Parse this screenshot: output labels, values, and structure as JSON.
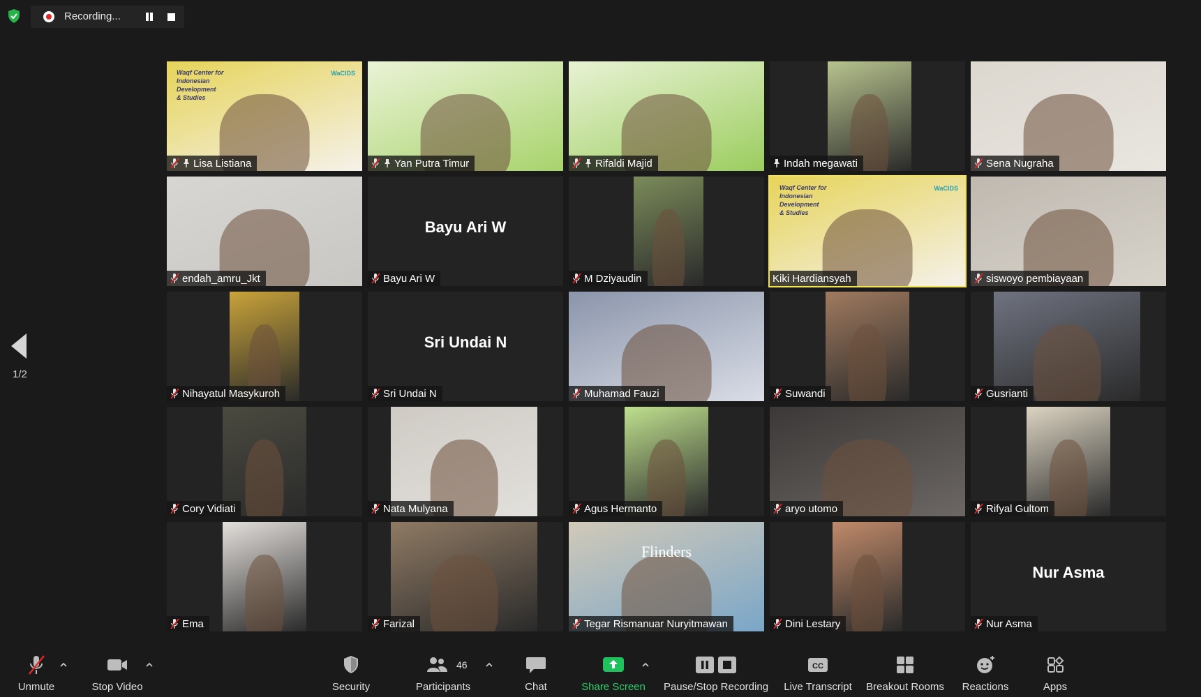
{
  "top_bar": {
    "recording_label": "Recording..."
  },
  "pager": {
    "indicator": "1/2"
  },
  "colors": {
    "active_speaker": "#f3e34d",
    "share": "#1ec15c",
    "mic_off": "#e02828"
  },
  "participants": [
    {
      "name": "Lisa Listiana",
      "muted": true,
      "pinned": true,
      "content": "video",
      "banner": "Waqf Center for\nIndonesian\nDevelopment\n& Studies",
      "brand": "WaCIDS"
    },
    {
      "name": "Yan Putra Timur",
      "muted": true,
      "pinned": true,
      "content": "video"
    },
    {
      "name": "Rifaldi Majid",
      "muted": true,
      "pinned": true,
      "content": "video"
    },
    {
      "name": "Indah megawati",
      "muted": false,
      "pinned": true,
      "content": "video"
    },
    {
      "name": "Sena Nugraha",
      "muted": true,
      "pinned": false,
      "content": "video"
    },
    {
      "name": "endah_amru_Jkt",
      "muted": true,
      "pinned": false,
      "content": "video"
    },
    {
      "name": "Bayu Ari W",
      "muted": true,
      "pinned": false,
      "content": "name",
      "display": "Bayu Ari W"
    },
    {
      "name": "M Dziyaudin",
      "muted": true,
      "pinned": false,
      "content": "video"
    },
    {
      "name": "Kiki Hardiansyah",
      "muted": false,
      "pinned": false,
      "content": "video",
      "active": true,
      "banner": "Waqf Center for\nIndonesian\nDevelopment\n& Studies",
      "brand": "WaCIDS"
    },
    {
      "name": "siswoyo pembiayaan",
      "muted": true,
      "pinned": false,
      "content": "video"
    },
    {
      "name": "Nihayatul Masykuroh",
      "muted": true,
      "pinned": false,
      "content": "video"
    },
    {
      "name": "Sri  Undai N",
      "muted": true,
      "pinned": false,
      "content": "name",
      "display": "Sri  Undai N"
    },
    {
      "name": "Muhamad Fauzi",
      "muted": true,
      "pinned": false,
      "content": "video"
    },
    {
      "name": "Suwandi",
      "muted": true,
      "pinned": false,
      "content": "video"
    },
    {
      "name": "Gusrianti",
      "muted": true,
      "pinned": false,
      "content": "video"
    },
    {
      "name": "Cory Vidiati",
      "muted": true,
      "pinned": false,
      "content": "video"
    },
    {
      "name": "Nata Mulyana",
      "muted": true,
      "pinned": false,
      "content": "video"
    },
    {
      "name": "Agus Hermanto",
      "muted": true,
      "pinned": false,
      "content": "video"
    },
    {
      "name": "aryo utomo",
      "muted": true,
      "pinned": false,
      "content": "video"
    },
    {
      "name": "Rifyal Gultom",
      "muted": true,
      "pinned": false,
      "content": "video"
    },
    {
      "name": "Ema",
      "muted": true,
      "pinned": false,
      "content": "video"
    },
    {
      "name": "Farizal",
      "muted": true,
      "pinned": false,
      "content": "video"
    },
    {
      "name": "Tegar Rismanuar Nuryitmawan",
      "muted": true,
      "pinned": false,
      "content": "video",
      "banner_text": "Flinders"
    },
    {
      "name": "Dini Lestary",
      "muted": true,
      "pinned": false,
      "content": "video"
    },
    {
      "name": "Nur Asma",
      "muted": true,
      "pinned": false,
      "content": "name",
      "display": "Nur Asma"
    }
  ],
  "toolbar": {
    "unmute": "Unmute",
    "stop_video": "Stop Video",
    "security": "Security",
    "participants": "Participants",
    "participants_count": "46",
    "chat": "Chat",
    "share_screen": "Share Screen",
    "pause_stop_recording": "Pause/Stop Recording",
    "live_transcript": "Live Transcript",
    "breakout_rooms": "Breakout Rooms",
    "reactions": "Reactions",
    "apps": "Apps"
  }
}
